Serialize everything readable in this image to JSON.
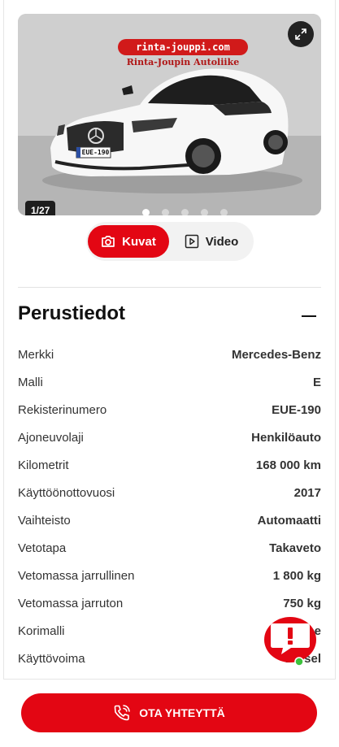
{
  "gallery": {
    "dealer_sign": "rinta-jouppi.com",
    "dealer_sub": "Rinta-Joupin Autoliike",
    "plate": "EUE-190",
    "counter": "1/27",
    "dot_count": 5,
    "active_dot": 0
  },
  "media_tabs": {
    "photos_label": "Kuvat",
    "video_label": "Video"
  },
  "section": {
    "title": "Perustiedot"
  },
  "specs": [
    {
      "label": "Merkki",
      "value": "Mercedes-Benz"
    },
    {
      "label": "Malli",
      "value": "E"
    },
    {
      "label": "Rekisterinumero",
      "value": "EUE-190"
    },
    {
      "label": "Ajoneuvolaji",
      "value": "Henkilöauto"
    },
    {
      "label": "Kilometrit",
      "value": "168 000 km"
    },
    {
      "label": "Käyttöönottovuosi",
      "value": "2017"
    },
    {
      "label": "Vaihteisto",
      "value": "Automaatti"
    },
    {
      "label": "Vetotapa",
      "value": "Takaveto"
    },
    {
      "label": "Vetomassa jarrullinen",
      "value": "1 800 kg"
    },
    {
      "label": "Vetomassa jarruton",
      "value": "750 kg"
    },
    {
      "label": "Korimalli",
      "value": "Coupe"
    },
    {
      "label": "Käyttövoima",
      "value": "Diesel"
    }
  ],
  "contact": {
    "label": "OTA YHTEYTTÄ"
  },
  "colors": {
    "accent": "#e30613",
    "chat_online": "#3cc23c"
  },
  "icons": {
    "expand": "expand-icon",
    "camera": "camera-icon",
    "video": "video-play-icon",
    "collapse": "minus-icon",
    "chat": "chat-alert-icon",
    "phone": "phone-call-icon"
  }
}
